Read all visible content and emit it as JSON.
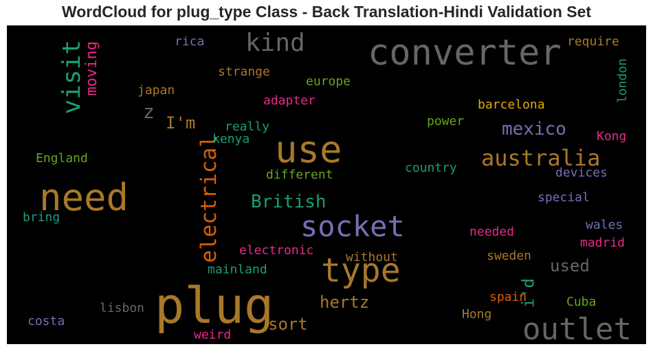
{
  "chart_data": {
    "type": "wordcloud",
    "title": "WordCloud for plug_type Class - Back Translation-Hindi Validation Set",
    "background_color": "#000000",
    "words": [
      {
        "text": "plug",
        "color": "#a9782a"
      },
      {
        "text": "converter",
        "color": "#666666"
      },
      {
        "text": "need",
        "color": "#a9782a"
      },
      {
        "text": "use",
        "color": "#a9782a"
      },
      {
        "text": "socket",
        "color": "#7570b3"
      },
      {
        "text": "type",
        "color": "#a9782a"
      },
      {
        "text": "outlet",
        "color": "#666666"
      },
      {
        "text": "australia",
        "color": "#a9782a"
      },
      {
        "text": "kind",
        "color": "#666666"
      },
      {
        "text": "visit",
        "color": "#1b9e77"
      },
      {
        "text": "electrical",
        "color": "#d95f02"
      },
      {
        "text": "British",
        "color": "#1b9e77"
      },
      {
        "text": "mexico",
        "color": "#7570b3"
      },
      {
        "text": "hertz",
        "color": "#a9782a"
      },
      {
        "text": "sort",
        "color": "#a9782a"
      },
      {
        "text": "moving",
        "color": "#e7298a"
      },
      {
        "text": "used",
        "color": "#666666"
      },
      {
        "text": "I'm",
        "color": "#a9782a"
      },
      {
        "text": "i'd",
        "color": "#1b9e77"
      },
      {
        "text": "z",
        "color": "#666666"
      },
      {
        "text": "require",
        "color": "#a9782a"
      },
      {
        "text": "london",
        "color": "#1b9e77"
      },
      {
        "text": "barcelona",
        "color": "#e6ab02"
      },
      {
        "text": "europe",
        "color": "#66a61e"
      },
      {
        "text": "strange",
        "color": "#a9782a"
      },
      {
        "text": "rica",
        "color": "#7570b3"
      },
      {
        "text": "japan",
        "color": "#a9782a"
      },
      {
        "text": "adapter",
        "color": "#e7298a"
      },
      {
        "text": "power",
        "color": "#66a61e"
      },
      {
        "text": "really",
        "color": "#1b9e77"
      },
      {
        "text": "kenya",
        "color": "#1b9e77"
      },
      {
        "text": "Kong",
        "color": "#e7298a"
      },
      {
        "text": "devices",
        "color": "#7570b3"
      },
      {
        "text": "country",
        "color": "#1b9e77"
      },
      {
        "text": "different",
        "color": "#66a61e"
      },
      {
        "text": "England",
        "color": "#66a61e"
      },
      {
        "text": "special",
        "color": "#7570b3"
      },
      {
        "text": "bring",
        "color": "#1b9e77"
      },
      {
        "text": "wales",
        "color": "#7570b3"
      },
      {
        "text": "needed",
        "color": "#e7298a"
      },
      {
        "text": "madrid",
        "color": "#e7298a"
      },
      {
        "text": "electronic",
        "color": "#e7298a"
      },
      {
        "text": "without",
        "color": "#a9782a"
      },
      {
        "text": "sweden",
        "color": "#a9782a"
      },
      {
        "text": "mainland",
        "color": "#1b9e77"
      },
      {
        "text": "spain",
        "color": "#d95f02"
      },
      {
        "text": "Cuba",
        "color": "#66a61e"
      },
      {
        "text": "lisbon",
        "color": "#666666"
      },
      {
        "text": "Hong",
        "color": "#a9782a"
      },
      {
        "text": "costa",
        "color": "#7570b3"
      },
      {
        "text": "weird",
        "color": "#e7298a"
      }
    ]
  }
}
